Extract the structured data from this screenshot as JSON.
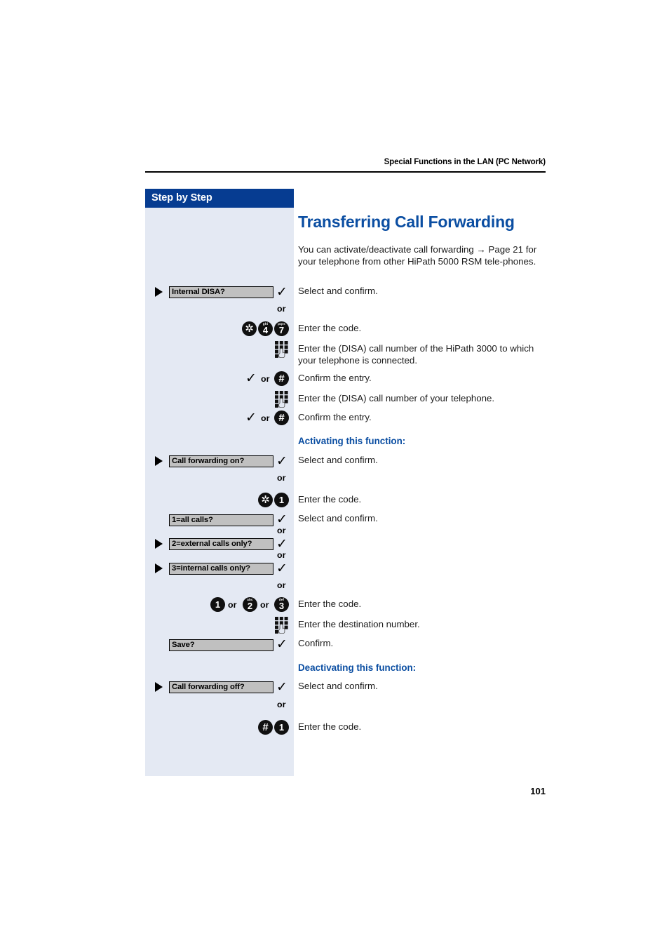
{
  "header": {
    "running_head": "Special Functions in the LAN (PC Network)",
    "sidebar_title": "Step by Step"
  },
  "page_number": "101",
  "main": {
    "title": "Transferring Call Forwarding",
    "intro": "You can activate/deactivate call forwarding → Page 21 for your telephone from other HiPath 5000 RSM tele-phones.",
    "subhead_activating": "Activating this function:",
    "subhead_deactivating": "Deactivating this function:"
  },
  "steps": [
    {
      "id": "internal-disa",
      "marker": true,
      "display_label": "Internal DISA?",
      "keys": [],
      "check": "✓",
      "or_after": true,
      "description": "Select and confirm."
    },
    {
      "id": "code-star-4-7",
      "marker": false,
      "display_label": null,
      "keys": [
        {
          "glyph": "✲",
          "sub": "",
          "type": "star"
        },
        {
          "glyph": "4",
          "sub": "ghi",
          "type": "digit"
        },
        {
          "glyph": "7",
          "sub": "pqrs",
          "type": "digit"
        }
      ],
      "check": null,
      "or_after": false,
      "description": "Enter the code."
    },
    {
      "id": "enter-disa-number-hipath3000",
      "marker": false,
      "display_label": null,
      "keys": [],
      "keypad": true,
      "check": null,
      "or_after": false,
      "description": "Enter the (DISA) call number of the HiPath 3000 to which your telephone is connected."
    },
    {
      "id": "confirm-entry-1",
      "marker": false,
      "display_label": null,
      "check": "✓",
      "or_inline": "or",
      "keys": [
        {
          "glyph": "#",
          "sub": "",
          "type": "hash"
        }
      ],
      "description": "Confirm the entry."
    },
    {
      "id": "enter-disa-number-own",
      "marker": false,
      "display_label": null,
      "keys": [],
      "keypad": true,
      "check": null,
      "description": "Enter the (DISA) call number of your telephone."
    },
    {
      "id": "confirm-entry-2",
      "marker": false,
      "display_label": null,
      "check": "✓",
      "or_inline": "or",
      "keys": [
        {
          "glyph": "#",
          "sub": "",
          "type": "hash"
        }
      ],
      "description": "Confirm the entry."
    },
    {
      "id": "call-forwarding-on",
      "marker": true,
      "display_label": "Call forwarding on?",
      "keys": [],
      "check": "✓",
      "or_after": true,
      "description": "Select and confirm."
    },
    {
      "id": "code-star-1",
      "marker": false,
      "display_label": null,
      "keys": [
        {
          "glyph": "✲",
          "sub": "",
          "type": "star"
        },
        {
          "glyph": "1",
          "sub": "",
          "type": "digit"
        }
      ],
      "check": null,
      "description": "Enter the code."
    },
    {
      "id": "all-calls",
      "marker": false,
      "display_label": "1=all calls?",
      "keys": [],
      "check": "✓",
      "or_after": true,
      "description": "Select and confirm."
    },
    {
      "id": "external-calls-only",
      "marker": true,
      "display_label": "2=external calls only?",
      "keys": [],
      "check": "✓",
      "or_after": true,
      "description": ""
    },
    {
      "id": "internal-calls-only",
      "marker": true,
      "display_label": "3=internal calls only?",
      "keys": [],
      "check": "✓",
      "or_after": true,
      "description": ""
    },
    {
      "id": "code-1-or-2-or-3",
      "marker": false,
      "display_label": null,
      "keys": [
        {
          "glyph": "1",
          "sub": "",
          "type": "digit"
        },
        {
          "glyph": "2",
          "sub": "abc",
          "type": "digit"
        },
        {
          "glyph": "3",
          "sub": "def",
          "type": "digit"
        }
      ],
      "separators": [
        "or",
        "or"
      ],
      "check": null,
      "description": "Enter the code."
    },
    {
      "id": "enter-destination-number",
      "marker": false,
      "display_label": null,
      "keys": [],
      "keypad": true,
      "check": null,
      "description": "Enter the destination number."
    },
    {
      "id": "save",
      "marker": false,
      "display_label": "Save?",
      "keys": [],
      "check": "✓",
      "description": "Confirm."
    },
    {
      "id": "call-forwarding-off",
      "marker": true,
      "display_label": "Call forwarding off?",
      "keys": [],
      "check": "✓",
      "or_after": true,
      "description": "Select and confirm."
    },
    {
      "id": "code-hash-1",
      "marker": false,
      "display_label": null,
      "keys": [
        {
          "glyph": "#",
          "sub": "",
          "type": "hash"
        },
        {
          "glyph": "1",
          "sub": "",
          "type": "digit"
        }
      ],
      "check": null,
      "description": "Enter the code."
    }
  ],
  "labels": {
    "or": "or"
  },
  "colors": {
    "accent_blue": "#0b4ea2",
    "sidebar_header": "#063c91",
    "sidebar_bg": "#e4e9f3",
    "display_box": "#c0c0c0",
    "key_black": "#101010"
  }
}
